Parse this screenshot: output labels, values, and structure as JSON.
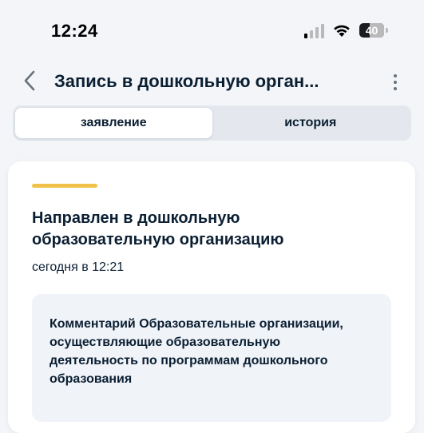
{
  "status_bar": {
    "time": "12:24",
    "battery_level": "40",
    "icons": [
      "signal-icon",
      "wifi-icon",
      "battery-icon"
    ]
  },
  "header": {
    "title": "Запись в дошкольную орган...",
    "back_icon": "chevron-left-icon",
    "more_icon": "more-vertical-icon"
  },
  "tabs": [
    {
      "label": "заявление",
      "active": true
    },
    {
      "label": "история",
      "active": false
    }
  ],
  "card": {
    "status_color": "#f0c24a",
    "title": "Направлен в дошкольную образовательную организацию",
    "date": "сегодня в 12:21",
    "comment": "Комментарий Образовательные организации, осуществляющие образовательную деятельность по программам дошкольного образования"
  },
  "colors": {
    "background": "#f3f5f8",
    "text": "#0b1f33",
    "accent_yellow": "#f0c24a",
    "tab_track": "#e4e8ee",
    "comment_bg": "#f0f3f8"
  }
}
